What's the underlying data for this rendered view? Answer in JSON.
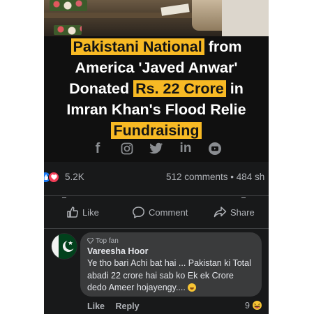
{
  "post": {
    "headline": {
      "line1_hl": "Pakistani National",
      "line1_rest": " from",
      "line2": "America 'Javed Anwar'",
      "line3_pre": "Donated ",
      "line3_hl": "Rs. 22 Crore",
      "line3_post": " in",
      "line4": "Imran Khan's Flood Relie",
      "line5_hl": "Fundraising"
    },
    "social_icons": [
      "facebook-icon",
      "instagram-icon",
      "twitter-icon",
      "linkedin-icon",
      "youtube-icon"
    ],
    "linkedin_text": "in",
    "facebook_text": "f"
  },
  "stats": {
    "reaction_count": "5.2K",
    "comments_shares": "512 comments • 484 sh"
  },
  "actions": {
    "like": "Like",
    "comment": "Comment",
    "share": "Share"
  },
  "comment": {
    "badge": "Top fan",
    "author": "Vareesha Hoor",
    "text": "Ye tho bari Achi bat hai ... Pakistan ki Total abadi 22 crore hai sab ko Ek ek Crore dedo Ameer hojayengy....",
    "like_label": "Like",
    "reply_label": "Reply",
    "reaction_count": "9"
  },
  "colors": {
    "background": "#18191a",
    "highlight": "#f7b924",
    "like_blue": "#1877f2",
    "love_red": "#f33e58"
  }
}
